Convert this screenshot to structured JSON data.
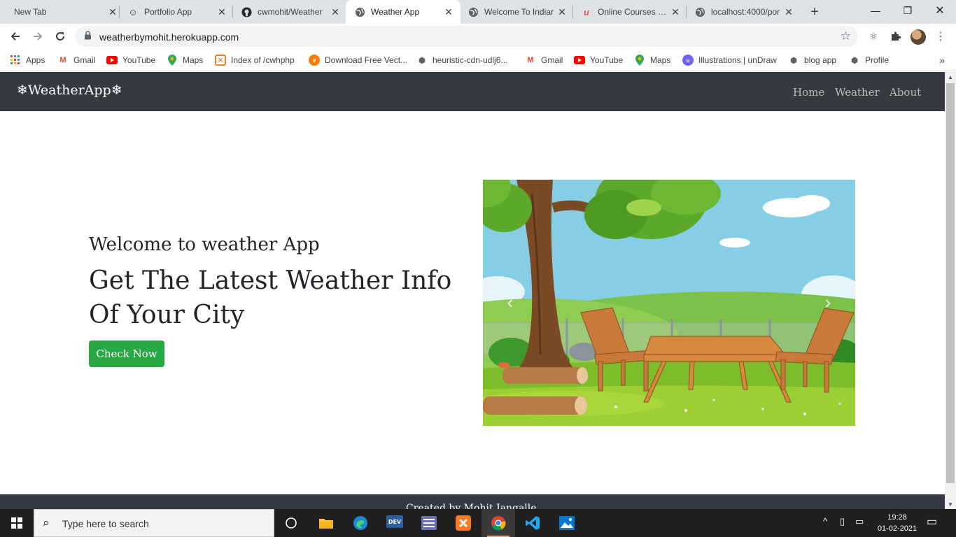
{
  "browser": {
    "tabs": [
      {
        "title": "New Tab",
        "icon": "none",
        "active": false
      },
      {
        "title": "Portfolio App",
        "icon": "smiley-icon",
        "active": false
      },
      {
        "title": "cwmohit/Weather",
        "icon": "github-icon",
        "active": false
      },
      {
        "title": "Weather App",
        "icon": "globe-icon",
        "active": true
      },
      {
        "title": "Welcome To Indiar",
        "icon": "globe-icon",
        "active": false
      },
      {
        "title": "Online Courses - A",
        "icon": "udemy-icon",
        "active": false
      },
      {
        "title": "localhost:4000/por",
        "icon": "globe-icon",
        "active": false
      }
    ],
    "url": "weatherbymohit.herokuapp.com",
    "bookmarks": [
      {
        "label": "Apps",
        "icon": "apps-grid-icon"
      },
      {
        "label": "Gmail",
        "icon": "gmail-icon"
      },
      {
        "label": "YouTube",
        "icon": "youtube-icon"
      },
      {
        "label": "Maps",
        "icon": "maps-pin-icon"
      },
      {
        "label": "Index of /cwhphp",
        "icon": "xampp-icon"
      },
      {
        "label": "Download Free Vect...",
        "icon": "vecteezy-icon"
      },
      {
        "label": "heuristic-cdn-udlj6...",
        "icon": "cube-icon"
      },
      {
        "label": "Gmail",
        "icon": "gmail-icon"
      },
      {
        "label": "YouTube",
        "icon": "youtube-icon"
      },
      {
        "label": "Maps",
        "icon": "maps-pin-icon"
      },
      {
        "label": "Illustrations | unDraw",
        "icon": "undraw-icon"
      },
      {
        "label": "blog app",
        "icon": "cube-icon"
      },
      {
        "label": "Profile",
        "icon": "cube-icon"
      }
    ],
    "more_label": "»"
  },
  "site": {
    "brand": "❄WeatherApp❄",
    "nav": {
      "home": "Home",
      "weather": "Weather",
      "about": "About"
    },
    "hero": {
      "welcome": "Welcome to weather App",
      "headline": "Get The Latest Weather Info Of Your City",
      "cta": "Check Now"
    },
    "footer": "Created by Mohit Jangalle ..."
  },
  "taskbar": {
    "search_placeholder": "Type here to search",
    "apps": [
      "task-view",
      "file-explorer",
      "edge",
      "dev",
      "xampp-control",
      "xampp",
      "chrome",
      "vscode",
      "photos"
    ],
    "clock_time": "19:28",
    "clock_date": "01-02-2021"
  },
  "colors": {
    "navbar": "#343a40",
    "cta": "#28a745",
    "tabstrip": "#dee1e6",
    "taskbar": "#202020"
  }
}
